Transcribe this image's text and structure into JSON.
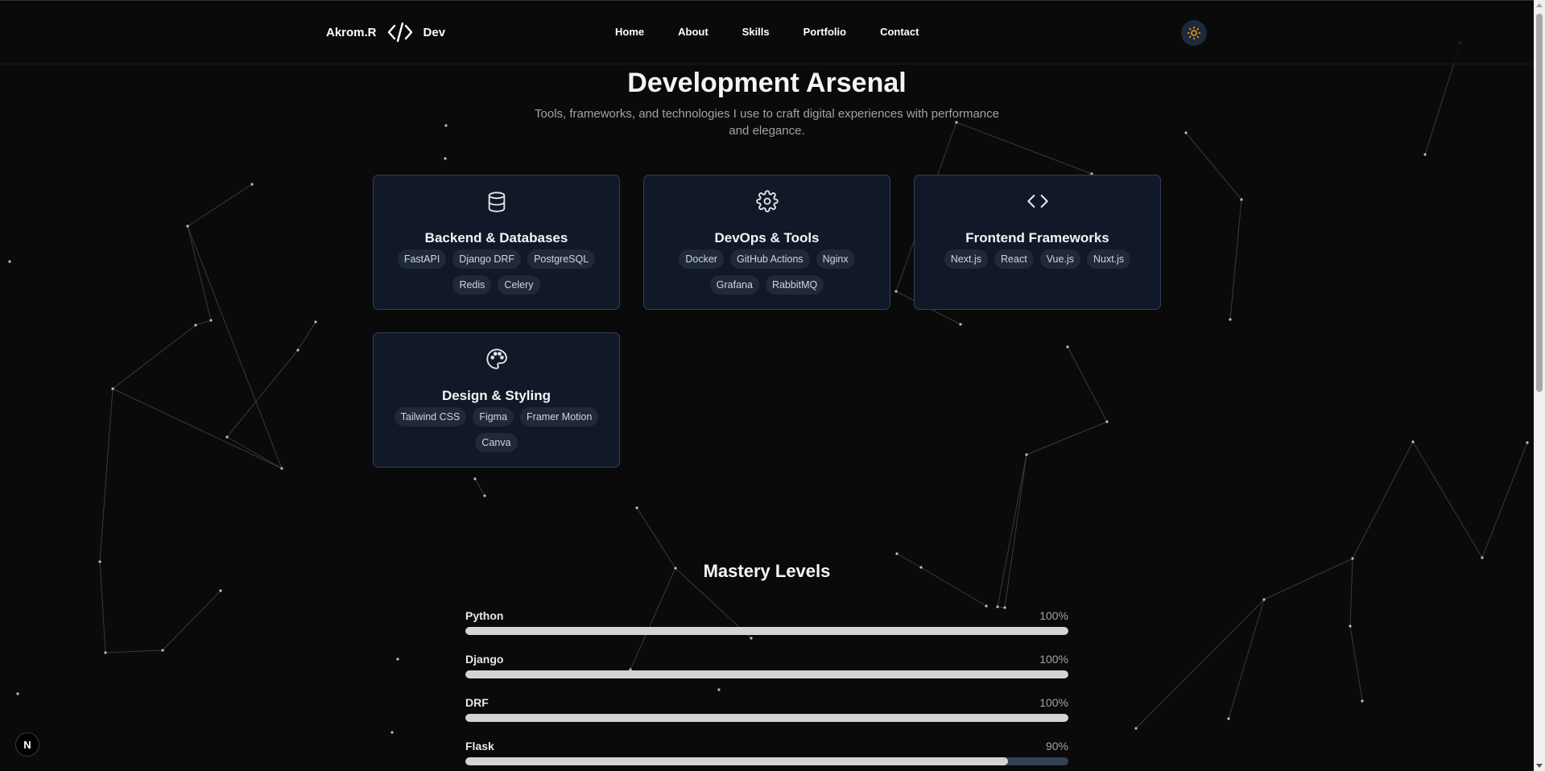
{
  "nav": {
    "logo_left": "Akrom.R",
    "logo_right": "Dev",
    "links": [
      "Home",
      "About",
      "Skills",
      "Portfolio",
      "Contact"
    ],
    "theme_toggle_icon": "sun-icon",
    "accent_color": "#f59e0b"
  },
  "arsenal": {
    "title": "Development Arsenal",
    "subtitle": "Tools, frameworks, and technologies I use to craft digital experiences with performance and elegance.",
    "cards": [
      {
        "icon": "database-icon",
        "title": "Backend & Databases",
        "tags": [
          "FastAPI",
          "Django DRF",
          "PostgreSQL",
          "Redis",
          "Celery"
        ]
      },
      {
        "icon": "gear-icon",
        "title": "DevOps & Tools",
        "tags": [
          "Docker",
          "GitHub Actions",
          "Nginx",
          "Grafana",
          "RabbitMQ"
        ]
      },
      {
        "icon": "code-icon",
        "title": "Frontend Frameworks",
        "tags": [
          "Next.js",
          "React",
          "Vue.js",
          "Nuxt.js"
        ]
      },
      {
        "icon": "palette-icon",
        "title": "Design & Styling",
        "tags": [
          "Tailwind CSS",
          "Figma",
          "Framer Motion",
          "Canva"
        ]
      }
    ]
  },
  "mastery": {
    "title": "Mastery Levels",
    "skills": [
      {
        "name": "Python",
        "percent_label": "100%",
        "level": 1.0
      },
      {
        "name": "Django",
        "percent_label": "100%",
        "level": 1.0
      },
      {
        "name": "DRF",
        "percent_label": "100%",
        "level": 1.0
      },
      {
        "name": "Flask",
        "percent_label": "90%",
        "level": 0.9
      }
    ]
  },
  "badge": {
    "label": "N"
  },
  "colors": {
    "background": "#0a0a0a",
    "card": "#111827",
    "card_border": "#334155",
    "bar_fill": "#d4d4d8",
    "bar_track": "#334155"
  }
}
